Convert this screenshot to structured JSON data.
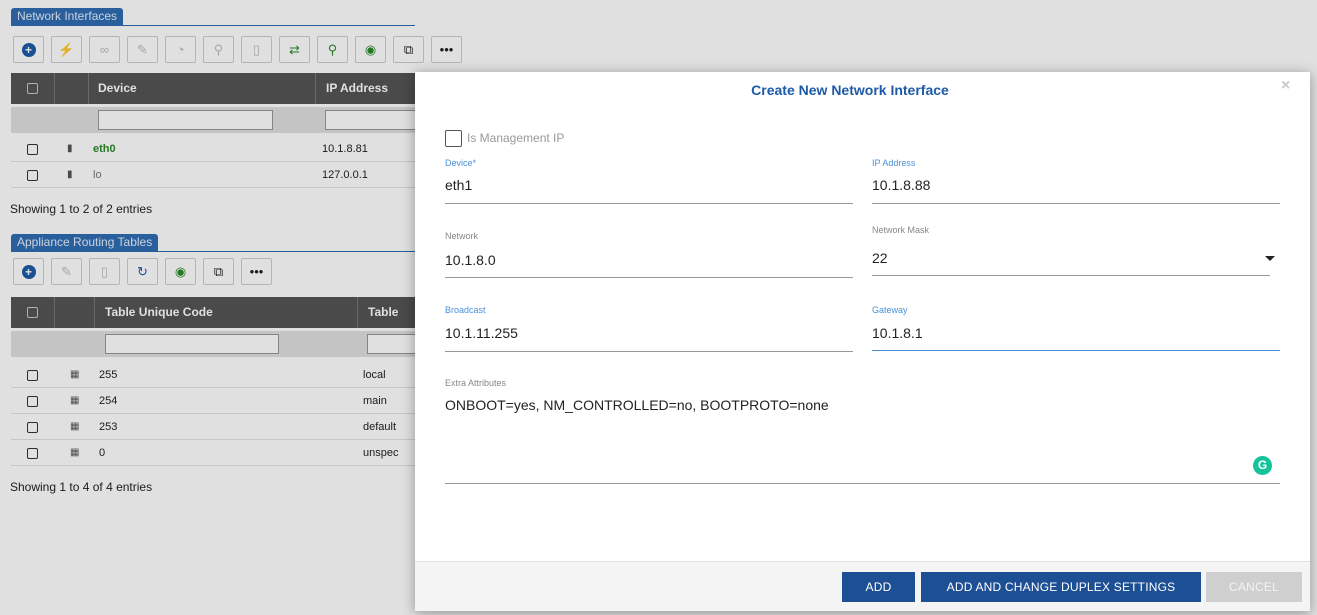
{
  "network_interfaces": {
    "title": "Network Interfaces",
    "columns": {
      "device": "Device",
      "ip_address": "IP Address"
    },
    "rows": [
      {
        "device": "eth0",
        "ip": "10.1.8.81"
      },
      {
        "device": "lo",
        "ip": "127.0.0.1"
      }
    ],
    "showing": "Showing 1 to 2 of 2 entries"
  },
  "routing_tables": {
    "title": "Appliance Routing Tables",
    "columns": {
      "code": "Table Unique Code",
      "name": "Table Nam"
    },
    "rows": [
      {
        "code": "255",
        "name": "local"
      },
      {
        "code": "254",
        "name": "main"
      },
      {
        "code": "253",
        "name": "default"
      },
      {
        "code": "0",
        "name": "unspec"
      }
    ],
    "showing": "Showing 1 to 4 of 4 entries"
  },
  "modal": {
    "title": "Create New Network Interface",
    "close": "×",
    "is_management_ip": "Is Management IP",
    "fields": {
      "device": {
        "label": "Device*",
        "value": "eth1"
      },
      "ip_address": {
        "label": "IP Address",
        "value": "10.1.8.88"
      },
      "network": {
        "label": "Network",
        "value": "10.1.8.0"
      },
      "network_mask": {
        "label": "Network Mask",
        "value": "22"
      },
      "broadcast": {
        "label": "Broadcast",
        "value": "10.1.11.255"
      },
      "gateway": {
        "label": "Gateway",
        "value": "10.1.8.1"
      },
      "extra_attributes": {
        "label": "Extra Attributes",
        "value": "ONBOOT=yes, NM_CONTROLLED=no, BOOTPROTO=none"
      }
    },
    "grammarly": "G",
    "buttons": {
      "add": "ADD",
      "add_duplex": "ADD AND CHANGE DUPLEX SETTINGS",
      "cancel": "CANCEL"
    }
  },
  "colors": {
    "primary": "#1d4f94",
    "title_blue": "#1d5aa8",
    "focus_blue": "#4a90d9",
    "header_gray": "#555555",
    "grammarly_green": "#15c39a"
  }
}
